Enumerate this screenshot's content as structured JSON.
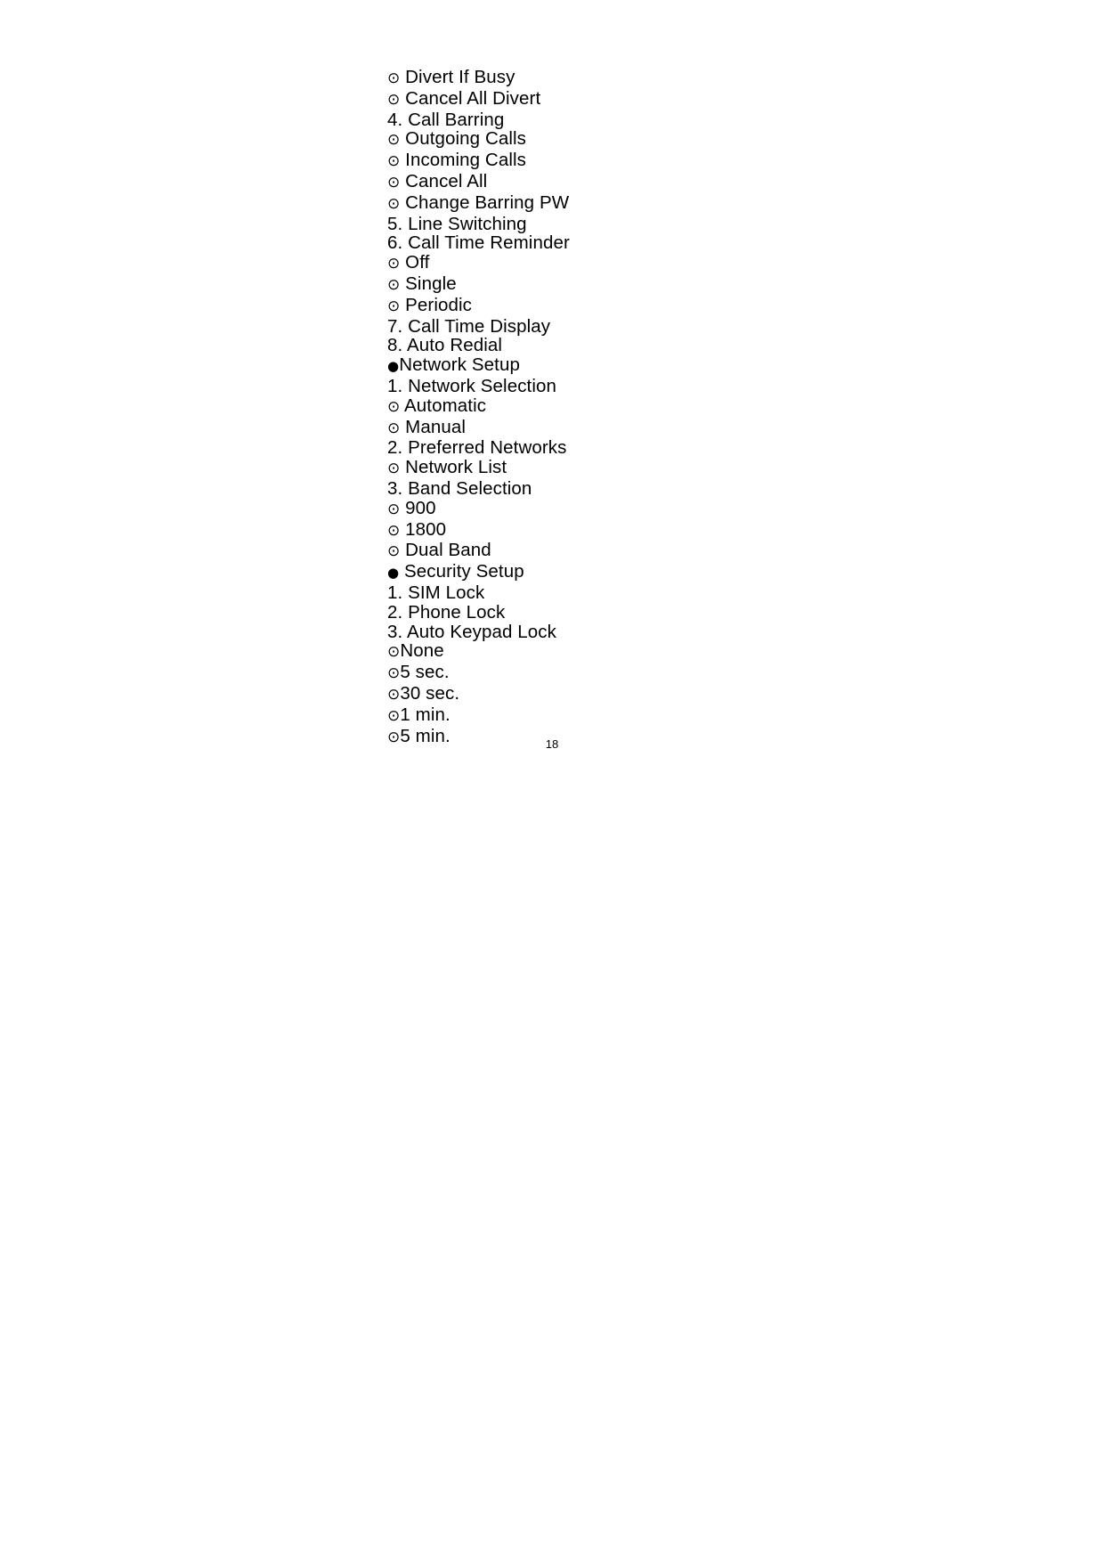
{
  "document": {
    "page_number": "18",
    "type": "menu-tree-outline"
  },
  "glyphs": {
    "radio": "⊙",
    "filled": "●"
  },
  "menu": {
    "lines": [
      {
        "marker": "radio",
        "gap": " ",
        "text": "Divert If Busy"
      },
      {
        "marker": "radio",
        "gap": " ",
        "text": "Cancel All Divert"
      },
      {
        "marker": "none",
        "gap": "",
        "text": "4. Call Barring"
      },
      {
        "marker": "radio",
        "gap": " ",
        "text": "Outgoing Calls"
      },
      {
        "marker": "radio",
        "gap": " ",
        "text": "Incoming Calls"
      },
      {
        "marker": "radio",
        "gap": " ",
        "text": "Cancel All"
      },
      {
        "marker": "radio",
        "gap": " ",
        "text": "Change Barring PW"
      },
      {
        "marker": "none",
        "gap": "",
        "text": "5. Line Switching"
      },
      {
        "marker": "none",
        "gap": "",
        "text": "6. Call Time Reminder"
      },
      {
        "marker": "radio",
        "gap": " ",
        "text": "Off"
      },
      {
        "marker": "radio",
        "gap": " ",
        "text": "Single"
      },
      {
        "marker": "radio",
        "gap": " ",
        "text": "Periodic"
      },
      {
        "marker": "none",
        "gap": "",
        "text": "7. Call Time Display"
      },
      {
        "marker": "none",
        "gap": "",
        "text": "8. Auto Redial"
      },
      {
        "marker": "filled",
        "gap": "",
        "text": "Network Setup"
      },
      {
        "marker": "none",
        "gap": "",
        "text": "1. Network Selection"
      },
      {
        "marker": "radio",
        "gap": " ",
        "text": "Automatic"
      },
      {
        "marker": "radio",
        "gap": " ",
        "text": "Manual"
      },
      {
        "marker": "none",
        "gap": "",
        "text": "2. Preferred Networks"
      },
      {
        "marker": "radio",
        "gap": " ",
        "text": "Network List"
      },
      {
        "marker": "none",
        "gap": "",
        "text": "3. Band Selection"
      },
      {
        "marker": "radio",
        "gap": " ",
        "text": "900"
      },
      {
        "marker": "radio",
        "gap": " ",
        "text": "1800"
      },
      {
        "marker": "radio",
        "gap": " ",
        "text": "Dual Band"
      },
      {
        "marker": "filled",
        "gap": " ",
        "text": "Security Setup"
      },
      {
        "marker": "none",
        "gap": "",
        "text": "1. SIM Lock"
      },
      {
        "marker": "none",
        "gap": "",
        "text": "2. Phone Lock"
      },
      {
        "marker": "none",
        "gap": "",
        "text": "3. Auto Keypad Lock"
      },
      {
        "marker": "radio",
        "gap": "",
        "text": "None"
      },
      {
        "marker": "radio",
        "gap": "",
        "text": "5 sec."
      },
      {
        "marker": "radio",
        "gap": "",
        "text": "30 sec."
      },
      {
        "marker": "radio",
        "gap": "",
        "text": "1 min."
      },
      {
        "marker": "radio",
        "gap": "",
        "text": "5 min."
      }
    ]
  }
}
